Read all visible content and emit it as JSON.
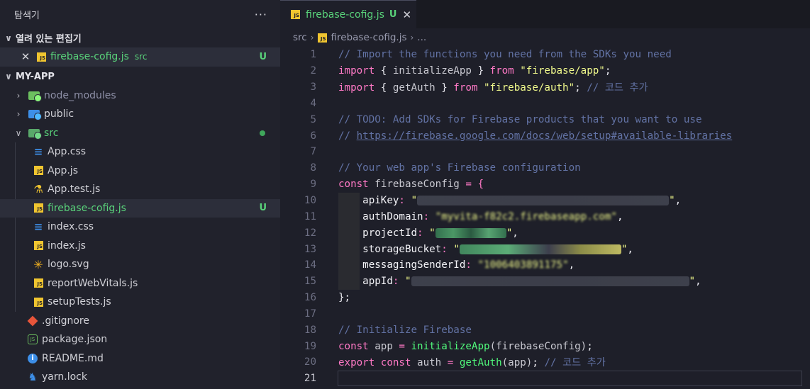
{
  "sidebar": {
    "title": "탐색기",
    "more_label": "···",
    "open_editors": {
      "title": "열려 있는 편집기",
      "items": [
        {
          "name": "firebase-cofig.js",
          "folder": "src",
          "badge": "U"
        }
      ]
    },
    "project": {
      "title": "MY-APP",
      "tree": [
        {
          "name": "node_modules",
          "kind": "folder",
          "expanded": false,
          "color": "#6cbf5f"
        },
        {
          "name": "public",
          "kind": "folder",
          "expanded": false,
          "color": "#3d8fe8"
        },
        {
          "name": "src",
          "kind": "folder",
          "expanded": true,
          "color": "#59d27a",
          "modified": true
        },
        {
          "name": "App.css",
          "kind": "css"
        },
        {
          "name": "App.js",
          "kind": "js"
        },
        {
          "name": "App.test.js",
          "kind": "test"
        },
        {
          "name": "firebase-cofig.js",
          "kind": "js",
          "badge": "U",
          "selected": true
        },
        {
          "name": "index.css",
          "kind": "css"
        },
        {
          "name": "index.js",
          "kind": "js"
        },
        {
          "name": "logo.svg",
          "kind": "svg"
        },
        {
          "name": "reportWebVitals.js",
          "kind": "js"
        },
        {
          "name": "setupTests.js",
          "kind": "js"
        },
        {
          "name": ".gitignore",
          "kind": "git"
        },
        {
          "name": "package.json",
          "kind": "npm"
        },
        {
          "name": "README.md",
          "kind": "info"
        },
        {
          "name": "yarn.lock",
          "kind": "yarn"
        }
      ]
    }
  },
  "editor": {
    "tab": {
      "name": "firebase-cofig.js",
      "badge": "U",
      "close": "✕"
    },
    "breadcrumb": {
      "folder": "src",
      "file": "firebase-cofig.js",
      "more": "..."
    },
    "colors": {
      "comment": "#6272a4",
      "keyword": "#ff79c6",
      "function": "#50fa7b",
      "string": "#f1fa8c"
    },
    "code": {
      "l1": "// Import the functions you need from the SDKs you need",
      "l2": {
        "kw": "import",
        "open": " { ",
        "name": "initializeApp",
        "close": " } ",
        "from": "from",
        "str": "\"firebase/app\"",
        "end": ";"
      },
      "l3": {
        "kw": "import",
        "open": " { ",
        "name": "getAuth",
        "close": " } ",
        "from": "from",
        "str": "\"firebase/auth\"",
        "end": "; ",
        "cm": "// 코드 추가"
      },
      "l5": "// TODO: Add SDKs for Firebase products that you want to use",
      "l6_prefix": "// ",
      "l6_url": "https://firebase.google.com/docs/web/setup#available-libraries",
      "l8": "// Your web app's Firebase configuration",
      "l9": {
        "kw": "const",
        "name": " firebaseConfig",
        "eq": " = {"
      },
      "l10": {
        "key": "apiKey",
        "colon": ": ",
        "q1": "\"",
        "q2": "\"",
        "end": ","
      },
      "l11": {
        "key": "authDomain",
        "colon": ": ",
        "val": "\"myvita-f82c2.firebaseapp.com\"",
        "end": ","
      },
      "l12": {
        "key": "projectId",
        "colon": ": ",
        "q1": "\"",
        "q2": "\"",
        "end": ","
      },
      "l13": {
        "key": "storageBucket",
        "colon": ": ",
        "q1": "\"",
        "q2": "\"",
        "end": ","
      },
      "l14": {
        "key": "messagingSenderId",
        "colon": ": ",
        "val": "\"1006403891175\"",
        "end": ","
      },
      "l15": {
        "key": "appId",
        "colon": ": ",
        "q1": "\"",
        "q2": "\"",
        "end": ","
      },
      "l16": "};",
      "l18": "// Initialize Firebase",
      "l19": {
        "kw": "const",
        "name": " app",
        "eq": " = ",
        "fn": "initializeApp",
        "arg": "(firebaseConfig)",
        "end": ";"
      },
      "l20": {
        "kw": "export",
        "kw2": " const",
        "name": " auth",
        "eq": " = ",
        "fn": "getAuth",
        "arg": "(app)",
        "end": "; ",
        "cm": "// 코드 추가"
      }
    },
    "line_numbers": [
      "1",
      "2",
      "3",
      "4",
      "5",
      "6",
      "7",
      "8",
      "9",
      "10",
      "11",
      "12",
      "13",
      "14",
      "15",
      "16",
      "17",
      "18",
      "19",
      "20",
      "21"
    ]
  }
}
